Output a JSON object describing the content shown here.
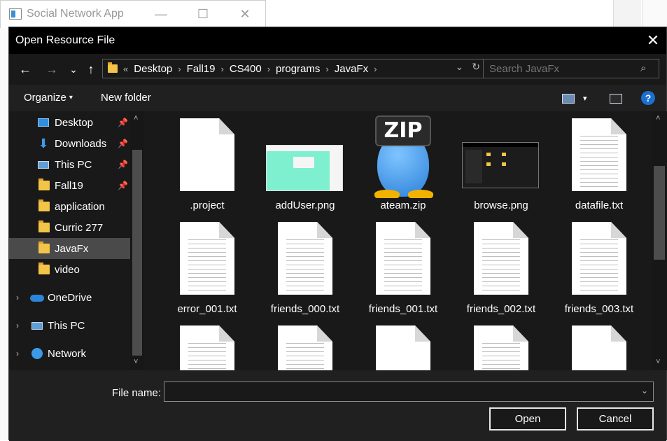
{
  "background_window": {
    "title": "Social Network App",
    "minimize_glyph": "—",
    "maximize_glyph": "☐",
    "close_glyph": "✕"
  },
  "dialog": {
    "title": "Open Resource File",
    "close_glyph": "✕"
  },
  "navigation": {
    "back_glyph": "←",
    "forward_glyph": "→",
    "recent_glyph": "⌄",
    "up_glyph": "↑",
    "breadcrumb_overflow": "«",
    "breadcrumbs": [
      "Desktop",
      "Fall19",
      "CS400",
      "programs",
      "JavaFx"
    ],
    "separator": "›",
    "dropdown_glyph": "⌄",
    "refresh_glyph": "↻"
  },
  "search": {
    "placeholder": "Search JavaFx",
    "icon_glyph": "⌕"
  },
  "toolbar": {
    "organize_label": "Organize",
    "organize_caret": "▾",
    "new_folder_label": "New folder",
    "view_caret": "▾",
    "help_glyph": "?"
  },
  "sidebar": {
    "pin_glyph": "📌",
    "expand_glyph": "›",
    "quick_access": [
      {
        "label": "Desktop",
        "icon": "desktop-icon",
        "pinned": true
      },
      {
        "label": "Downloads",
        "icon": "downloads-icon",
        "pinned": true
      },
      {
        "label": "This PC",
        "icon": "pc-icon",
        "pinned": true
      },
      {
        "label": "Fall19",
        "icon": "folder-icon",
        "pinned": true
      },
      {
        "label": "application",
        "icon": "folder-icon",
        "pinned": false
      },
      {
        "label": "Curric 277",
        "icon": "folder-icon",
        "pinned": false
      },
      {
        "label": "JavaFx",
        "icon": "folder-icon",
        "pinned": false,
        "selected": true
      },
      {
        "label": "video",
        "icon": "folder-icon",
        "pinned": false
      }
    ],
    "roots": [
      {
        "label": "OneDrive",
        "icon": "cloud-icon"
      },
      {
        "label": "This PC",
        "icon": "pc-icon"
      },
      {
        "label": "Network",
        "icon": "network-icon"
      }
    ],
    "scroll_up_glyph": "˄",
    "scroll_down_glyph": "˅"
  },
  "files": [
    {
      "name": ".project",
      "type": "blank"
    },
    {
      "name": "addUser.png",
      "type": "image-green"
    },
    {
      "name": "ateam.zip",
      "type": "zip"
    },
    {
      "name": "browse.png",
      "type": "image-dark"
    },
    {
      "name": "datafile.txt",
      "type": "text"
    },
    {
      "name": "error_001.txt",
      "type": "text"
    },
    {
      "name": "friends_000.txt",
      "type": "text"
    },
    {
      "name": "friends_001.txt",
      "type": "text"
    },
    {
      "name": "friends_002.txt",
      "type": "text"
    },
    {
      "name": "friends_003.txt",
      "type": "text"
    },
    {
      "name": "",
      "type": "text"
    },
    {
      "name": "",
      "type": "text"
    },
    {
      "name": "",
      "type": "blank"
    },
    {
      "name": "",
      "type": "text"
    },
    {
      "name": "",
      "type": "blank"
    }
  ],
  "zip_icon_text": "ZIP",
  "footer": {
    "file_name_label": "File name:",
    "file_name_value": "",
    "dropdown_glyph": "⌄",
    "open_label": "Open",
    "cancel_label": "Cancel"
  },
  "colors": {
    "dialog_bg": "#202020",
    "pane_bg": "#191919",
    "title_bg": "#000000",
    "selected_bg": "#4a4a4a",
    "folder_yellow": "#f3c447",
    "help_blue": "#1b6fd0"
  }
}
